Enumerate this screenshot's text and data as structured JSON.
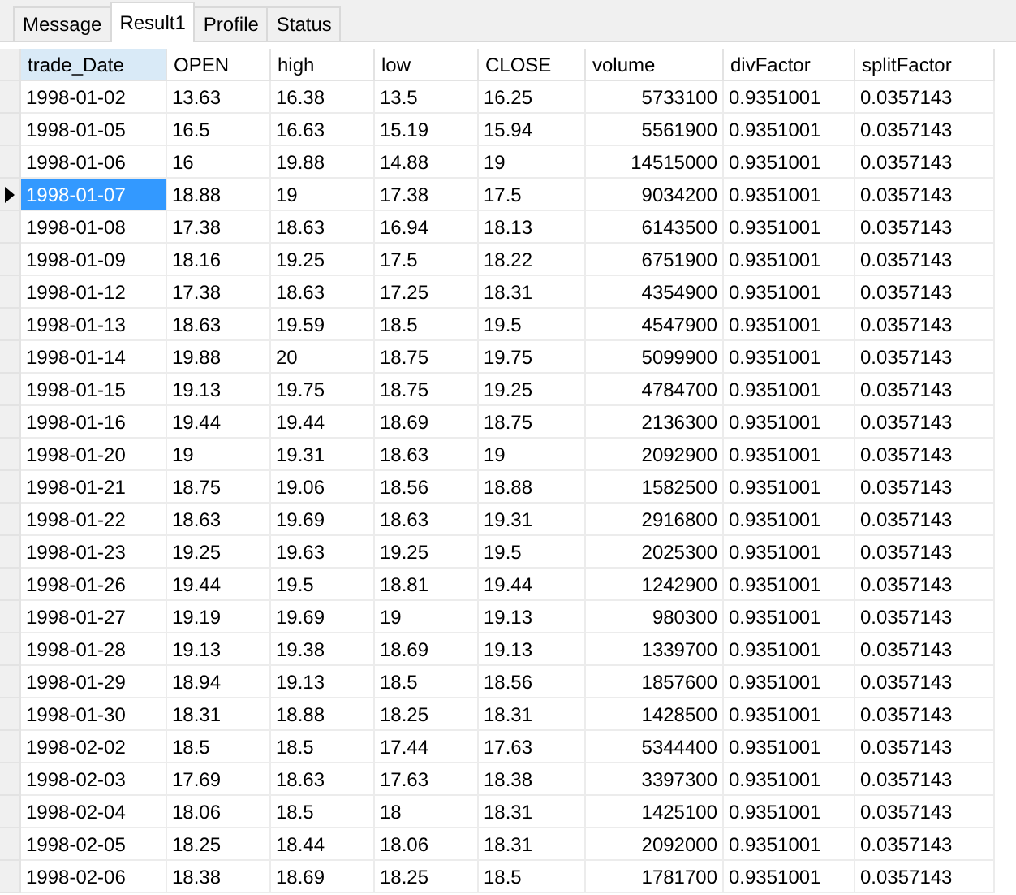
{
  "tabs": [
    {
      "label": "Message",
      "selected": false
    },
    {
      "label": "Result1",
      "selected": true
    },
    {
      "label": "Profile",
      "selected": false
    },
    {
      "label": "Status",
      "selected": false
    }
  ],
  "table": {
    "columns": [
      {
        "label": "trade_Date",
        "selected": true
      },
      {
        "label": "OPEN",
        "selected": false
      },
      {
        "label": "high",
        "selected": false
      },
      {
        "label": "low",
        "selected": false
      },
      {
        "label": "CLOSE",
        "selected": false
      },
      {
        "label": "volume",
        "selected": false
      },
      {
        "label": "divFactor",
        "selected": false
      },
      {
        "label": "splitFactor",
        "selected": false
      }
    ],
    "rows": [
      {
        "selected": false,
        "cells": [
          "1998-01-02",
          "13.63",
          "16.38",
          "13.5",
          "16.25",
          "5733100",
          "0.9351001",
          "0.0357143"
        ]
      },
      {
        "selected": false,
        "cells": [
          "1998-01-05",
          "16.5",
          "16.63",
          "15.19",
          "15.94",
          "5561900",
          "0.9351001",
          "0.0357143"
        ]
      },
      {
        "selected": false,
        "cells": [
          "1998-01-06",
          "16",
          "19.88",
          "14.88",
          "19",
          "14515000",
          "0.9351001",
          "0.0357143"
        ]
      },
      {
        "selected": true,
        "cells": [
          "1998-01-07",
          "18.88",
          "19",
          "17.38",
          "17.5",
          "9034200",
          "0.9351001",
          "0.0357143"
        ]
      },
      {
        "selected": false,
        "cells": [
          "1998-01-08",
          "17.38",
          "18.63",
          "16.94",
          "18.13",
          "6143500",
          "0.9351001",
          "0.0357143"
        ]
      },
      {
        "selected": false,
        "cells": [
          "1998-01-09",
          "18.16",
          "19.25",
          "17.5",
          "18.22",
          "6751900",
          "0.9351001",
          "0.0357143"
        ]
      },
      {
        "selected": false,
        "cells": [
          "1998-01-12",
          "17.38",
          "18.63",
          "17.25",
          "18.31",
          "4354900",
          "0.9351001",
          "0.0357143"
        ]
      },
      {
        "selected": false,
        "cells": [
          "1998-01-13",
          "18.63",
          "19.59",
          "18.5",
          "19.5",
          "4547900",
          "0.9351001",
          "0.0357143"
        ]
      },
      {
        "selected": false,
        "cells": [
          "1998-01-14",
          "19.88",
          "20",
          "18.75",
          "19.75",
          "5099900",
          "0.9351001",
          "0.0357143"
        ]
      },
      {
        "selected": false,
        "cells": [
          "1998-01-15",
          "19.13",
          "19.75",
          "18.75",
          "19.25",
          "4784700",
          "0.9351001",
          "0.0357143"
        ]
      },
      {
        "selected": false,
        "cells": [
          "1998-01-16",
          "19.44",
          "19.44",
          "18.69",
          "18.75",
          "2136300",
          "0.9351001",
          "0.0357143"
        ]
      },
      {
        "selected": false,
        "cells": [
          "1998-01-20",
          "19",
          "19.31",
          "18.63",
          "19",
          "2092900",
          "0.9351001",
          "0.0357143"
        ]
      },
      {
        "selected": false,
        "cells": [
          "1998-01-21",
          "18.75",
          "19.06",
          "18.56",
          "18.88",
          "1582500",
          "0.9351001",
          "0.0357143"
        ]
      },
      {
        "selected": false,
        "cells": [
          "1998-01-22",
          "18.63",
          "19.69",
          "18.63",
          "19.31",
          "2916800",
          "0.9351001",
          "0.0357143"
        ]
      },
      {
        "selected": false,
        "cells": [
          "1998-01-23",
          "19.25",
          "19.63",
          "19.25",
          "19.5",
          "2025300",
          "0.9351001",
          "0.0357143"
        ]
      },
      {
        "selected": false,
        "cells": [
          "1998-01-26",
          "19.44",
          "19.5",
          "18.81",
          "19.44",
          "1242900",
          "0.9351001",
          "0.0357143"
        ]
      },
      {
        "selected": false,
        "cells": [
          "1998-01-27",
          "19.19",
          "19.69",
          "19",
          "19.13",
          "980300",
          "0.9351001",
          "0.0357143"
        ]
      },
      {
        "selected": false,
        "cells": [
          "1998-01-28",
          "19.13",
          "19.38",
          "18.69",
          "19.13",
          "1339700",
          "0.9351001",
          "0.0357143"
        ]
      },
      {
        "selected": false,
        "cells": [
          "1998-01-29",
          "18.94",
          "19.13",
          "18.5",
          "18.56",
          "1857600",
          "0.9351001",
          "0.0357143"
        ]
      },
      {
        "selected": false,
        "cells": [
          "1998-01-30",
          "18.31",
          "18.88",
          "18.25",
          "18.31",
          "1428500",
          "0.9351001",
          "0.0357143"
        ]
      },
      {
        "selected": false,
        "cells": [
          "1998-02-02",
          "18.5",
          "18.5",
          "17.44",
          "17.63",
          "5344400",
          "0.9351001",
          "0.0357143"
        ]
      },
      {
        "selected": false,
        "cells": [
          "1998-02-03",
          "17.69",
          "18.63",
          "17.63",
          "18.38",
          "3397300",
          "0.9351001",
          "0.0357143"
        ]
      },
      {
        "selected": false,
        "cells": [
          "1998-02-04",
          "18.06",
          "18.5",
          "18",
          "18.31",
          "1425100",
          "0.9351001",
          "0.0357143"
        ]
      },
      {
        "selected": false,
        "cells": [
          "1998-02-05",
          "18.25",
          "18.44",
          "18.06",
          "18.31",
          "2092000",
          "0.9351001",
          "0.0357143"
        ]
      },
      {
        "selected": false,
        "cells": [
          "1998-02-06",
          "18.38",
          "18.69",
          "18.25",
          "18.5",
          "1781700",
          "0.9351001",
          "0.0357143"
        ]
      }
    ]
  }
}
